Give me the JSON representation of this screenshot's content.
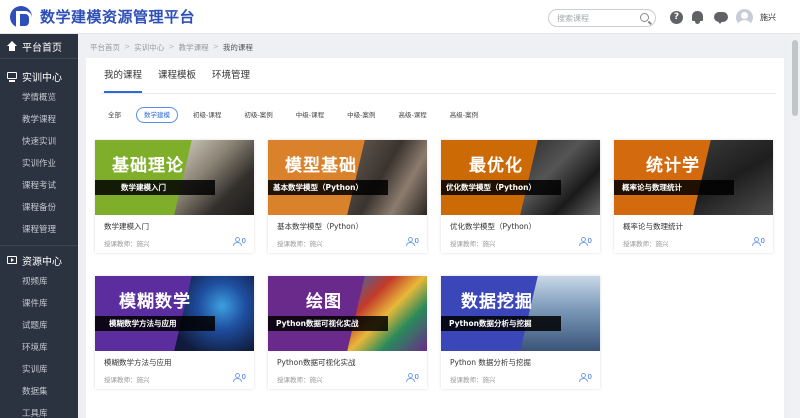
{
  "header": {
    "app_title": "数学建模资源管理平台",
    "search_placeholder": "搜索课程",
    "username": "施兴"
  },
  "sidebar": {
    "sections": [
      {
        "label": "平台首页",
        "icon": "home-icon",
        "items": []
      },
      {
        "label": "实训中心",
        "icon": "monitor-icon",
        "items": [
          "学情概览",
          "教学课程",
          "快速实训",
          "实训作业",
          "课程考试",
          "课程备份",
          "课程管理"
        ]
      },
      {
        "label": "资源中心",
        "icon": "media-icon",
        "items": [
          "视频库",
          "课件库",
          "试题库",
          "环境库",
          "实训库",
          "数据集",
          "工具库"
        ]
      }
    ]
  },
  "breadcrumb": [
    "平台首页",
    "实训中心",
    "教学课程",
    "我的课程"
  ],
  "tabs": [
    "我的课程",
    "课程模板",
    "环境管理"
  ],
  "filters": [
    "全部",
    "数学建模",
    "初级-课程",
    "初级-案例",
    "中级-课程",
    "中级-案例",
    "高级-课程",
    "高级-案例"
  ],
  "active_filter": "数学建模",
  "courses": [
    {
      "cover_title": "基础理论",
      "cover_subtitle": "数学建模入门",
      "name": "数学建模入门",
      "teacher": "授课教师：施兴",
      "count": "0",
      "color": "#7fae2b"
    },
    {
      "cover_title": "模型基础",
      "cover_subtitle": "基本数学模型（Python）",
      "name": "基本数学模型（Python）",
      "teacher": "授课教师：施兴",
      "count": "0",
      "color": "#d9822b"
    },
    {
      "cover_title": "最优化",
      "cover_subtitle": "优化数学模型（Python）",
      "name": "优化数学模型（Python）",
      "teacher": "授课教师：施兴",
      "count": "0",
      "color": "#cc6a05"
    },
    {
      "cover_title": "统计学",
      "cover_subtitle": "概率论与数理统计",
      "name": "概率论与数理统计",
      "teacher": "授课教师：施兴",
      "count": "0",
      "color": "#d46a0e"
    },
    {
      "cover_title": "模糊数学",
      "cover_subtitle": "模糊数学方法与应用",
      "name": "模糊数学方法与应用",
      "teacher": "授课教师：施兴",
      "count": "0",
      "color": "#5b2d9e"
    },
    {
      "cover_title": "绘图",
      "cover_subtitle": "Python数据可视化实战",
      "name": "Python数据可视化实战",
      "teacher": "授课教师：施兴",
      "count": "0",
      "color": "#6a2a8c"
    },
    {
      "cover_title": "数据挖掘",
      "cover_subtitle": "Python数据分析与挖掘",
      "name": "Python 数据分析与挖掘",
      "teacher": "授课教师：施兴",
      "count": "0",
      "color": "#3b47b8"
    }
  ]
}
